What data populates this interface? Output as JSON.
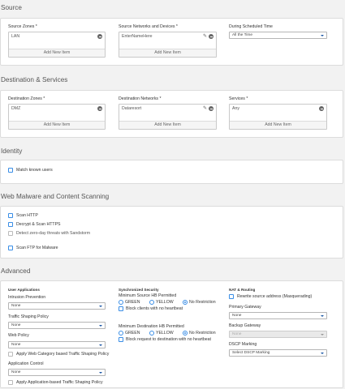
{
  "source": {
    "title": "Source",
    "zones_label": "Source Zones *",
    "zones_item": "LAN",
    "networks_label": "Source Networks and Devices *",
    "networks_item": "EnterNameHere",
    "schedule_label": "During Scheduled Time",
    "schedule_value": "All the Time",
    "add_label": "Add New Item"
  },
  "destination": {
    "title": "Destination & Services",
    "zones_label": "Destination Zones *",
    "zones_item": "DMZ",
    "networks_label": "Destination Networks *",
    "networks_item": "Dataresort",
    "services_label": "Services *",
    "services_item": "Any",
    "add_label": "Add New Item"
  },
  "identity": {
    "title": "Identity",
    "match_known_users": "Match known users"
  },
  "malware": {
    "title": "Web Malware and Content Scanning",
    "scan_http": "Scan HTTP",
    "decrypt_https": "Decrypt & Scan HTTPS",
    "zero_day": "Detect zero-day threats with Sandstorm",
    "scan_ftp": "Scan FTP for Malware"
  },
  "advanced": {
    "title": "Advanced",
    "user_apps": {
      "heading": "User Applications",
      "intrusion_label": "Intrusion Prevention",
      "intrusion_value": "None",
      "shaping_label": "Traffic Shaping Policy",
      "shaping_value": "None",
      "web_policy_label": "Web Policy",
      "web_policy_value": "None",
      "apply_web_category": "Apply Web Category based Traffic Shaping Policy",
      "app_control_label": "Application Control",
      "app_control_value": "None",
      "apply_app_based": "Apply Application-based Traffic Shaping Policy"
    },
    "sync_security": {
      "heading": "Synchronized Security",
      "min_source_label": "Minimum Source HB Permitted",
      "min_dest_label": "Minimum Destination HB Permitted",
      "green": "GREEN",
      "yellow": "YELLOW",
      "no_restriction": "No Restriction",
      "block_clients": "Block clients with no heartbeat",
      "block_request": "Block request to destination with no heartbeat"
    },
    "nat": {
      "heading": "NAT & Routing",
      "rewrite": "Rewrite source address (Masquerading)",
      "primary_label": "Primary Gateway",
      "primary_value": "None",
      "backup_label": "Backup Gateway",
      "backup_value": "None",
      "dscp_label": "DSCP Marking",
      "dscp_value": "Select DSCP Marking"
    }
  }
}
